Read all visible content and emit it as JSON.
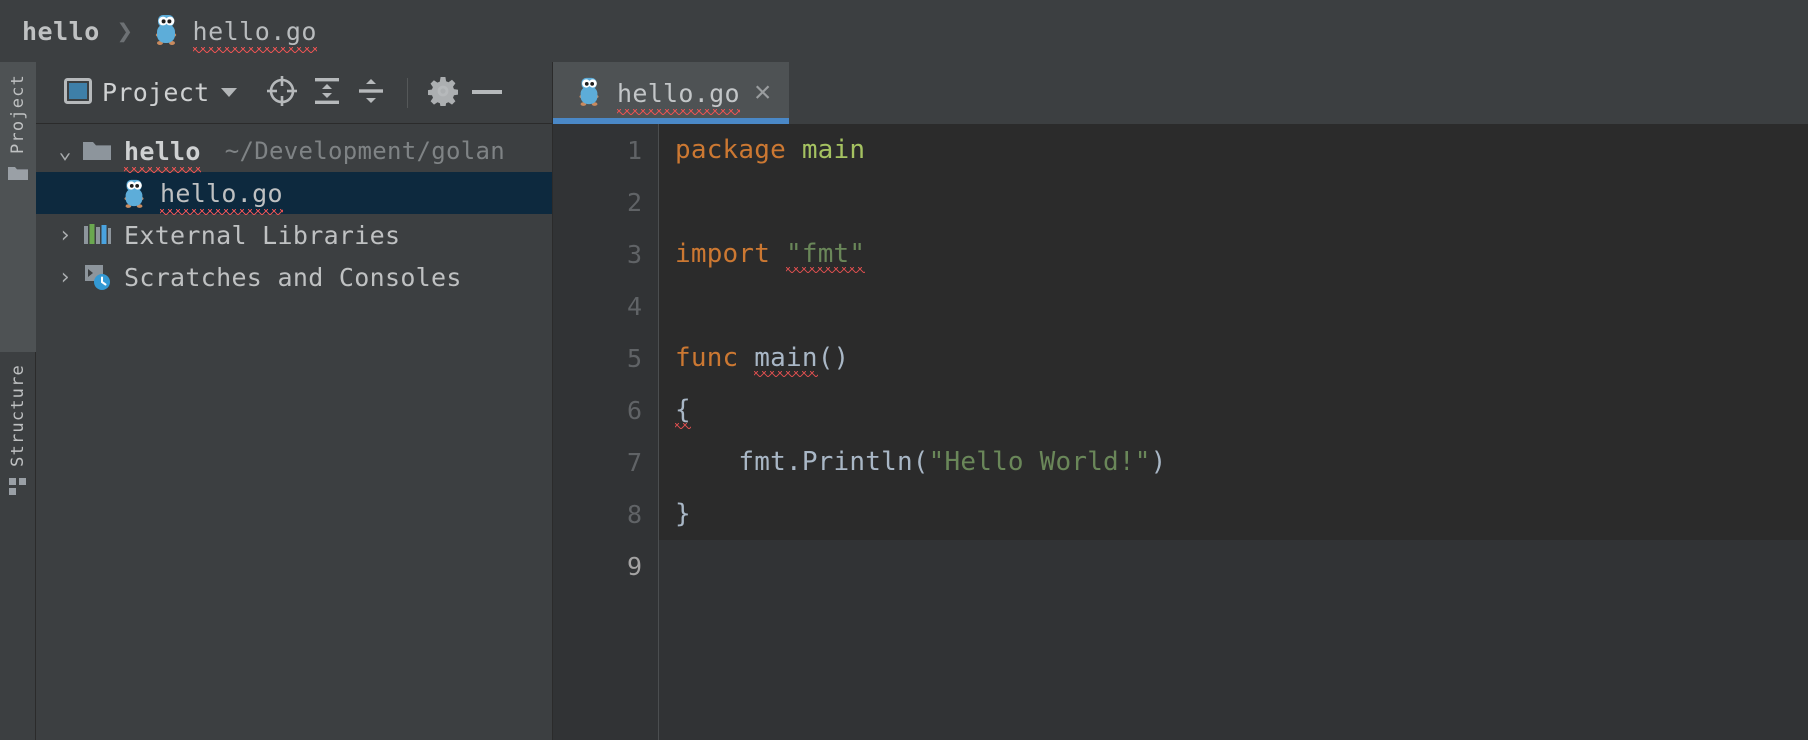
{
  "breadcrumb": {
    "project": "hello",
    "separator": "❯",
    "file": "hello.go",
    "file_icon": "go-gopher-icon"
  },
  "tool_strip": {
    "tabs": [
      {
        "label": "Project",
        "icon": "folder-icon",
        "active": true
      },
      {
        "label": "Structure",
        "icon": "structure-grid-icon",
        "active": false
      }
    ]
  },
  "project_panel": {
    "toolbar": {
      "view_selector_label": "Project",
      "view_selector_icon": "project-view-icon",
      "caret_icon": "chevron-down-icon",
      "buttons": [
        {
          "name": "select-opened-file",
          "icon": "crosshair-target-icon"
        },
        {
          "name": "expand-all",
          "icon": "expand-all-icon"
        },
        {
          "name": "collapse-all",
          "icon": "collapse-all-icon"
        },
        {
          "name": "settings",
          "icon": "gear-icon"
        },
        {
          "name": "hide-panel",
          "icon": "minimize-icon"
        }
      ]
    },
    "tree": [
      {
        "label": "hello",
        "sublabel": "~/Development/golan",
        "icon": "folder-icon",
        "twisty": "⌄",
        "expanded": true,
        "selected": false,
        "bold": true,
        "squiggle": true,
        "indent": 0
      },
      {
        "label": "hello.go",
        "sublabel": "",
        "icon": "go-gopher-icon",
        "twisty": "",
        "expanded": false,
        "selected": true,
        "bold": false,
        "squiggle": true,
        "indent": 1
      },
      {
        "label": "External Libraries",
        "sublabel": "",
        "icon": "libraries-icon",
        "twisty": "›",
        "expanded": false,
        "selected": false,
        "bold": false,
        "squiggle": false,
        "indent": 0
      },
      {
        "label": "Scratches and Consoles",
        "sublabel": "",
        "icon": "scratches-console-clock-icon",
        "twisty": "›",
        "expanded": false,
        "selected": false,
        "bold": false,
        "squiggle": false,
        "indent": 0
      }
    ]
  },
  "editor": {
    "tab": {
      "label": "hello.go",
      "icon": "go-gopher-icon",
      "close_icon": "×",
      "active": true,
      "squiggle": true
    },
    "gutter": {
      "line_numbers": [
        "1",
        "2",
        "3",
        "4",
        "5",
        "6",
        "7",
        "8",
        "9"
      ],
      "current_line": "9",
      "run_marker_line": "5",
      "run_marker_icon": "run-gutter-arrow-icon"
    },
    "lines": [
      {
        "number": "1",
        "tokens": [
          {
            "text": "package ",
            "style": "kw"
          },
          {
            "text": "main",
            "style": "green"
          }
        ]
      },
      {
        "number": "2",
        "tokens": []
      },
      {
        "number": "3",
        "tokens": [
          {
            "text": "import ",
            "style": "kw"
          },
          {
            "text": "\"fmt\"",
            "style": "str-squiggle"
          }
        ]
      },
      {
        "number": "4",
        "tokens": []
      },
      {
        "number": "5",
        "tokens": [
          {
            "text": "func ",
            "style": "kw"
          },
          {
            "text": "main",
            "style": "plain-squiggle"
          },
          {
            "text": "()",
            "style": "plain"
          }
        ]
      },
      {
        "number": "6",
        "tokens": [
          {
            "text": "{",
            "style": "plain-squiggle"
          }
        ]
      },
      {
        "number": "7",
        "tokens": [
          {
            "text": "    fmt.Println(",
            "style": "plain"
          },
          {
            "text": "\"Hello World!\"",
            "style": "str"
          },
          {
            "text": ")",
            "style": "plain"
          }
        ]
      },
      {
        "number": "8",
        "tokens": [
          {
            "text": "}",
            "style": "plain"
          }
        ]
      },
      {
        "number": "9",
        "tokens": []
      }
    ]
  },
  "colors": {
    "panel_bg": "#3c3f41",
    "editor_bg": "#2b2b2b",
    "gutter_bg": "#313335",
    "selection_bg": "#0d293e",
    "tab_active_bg": "#4e5254",
    "tab_underline": "#4a88c7",
    "keyword": "#cc7832",
    "string": "#6a8759",
    "package_name": "#a5c261",
    "plain_text": "#a9b7c6",
    "error_squiggle": "#cc4b4b",
    "run_arrow": "#3c9e3c",
    "gopher_blue": "#5dadd9"
  }
}
